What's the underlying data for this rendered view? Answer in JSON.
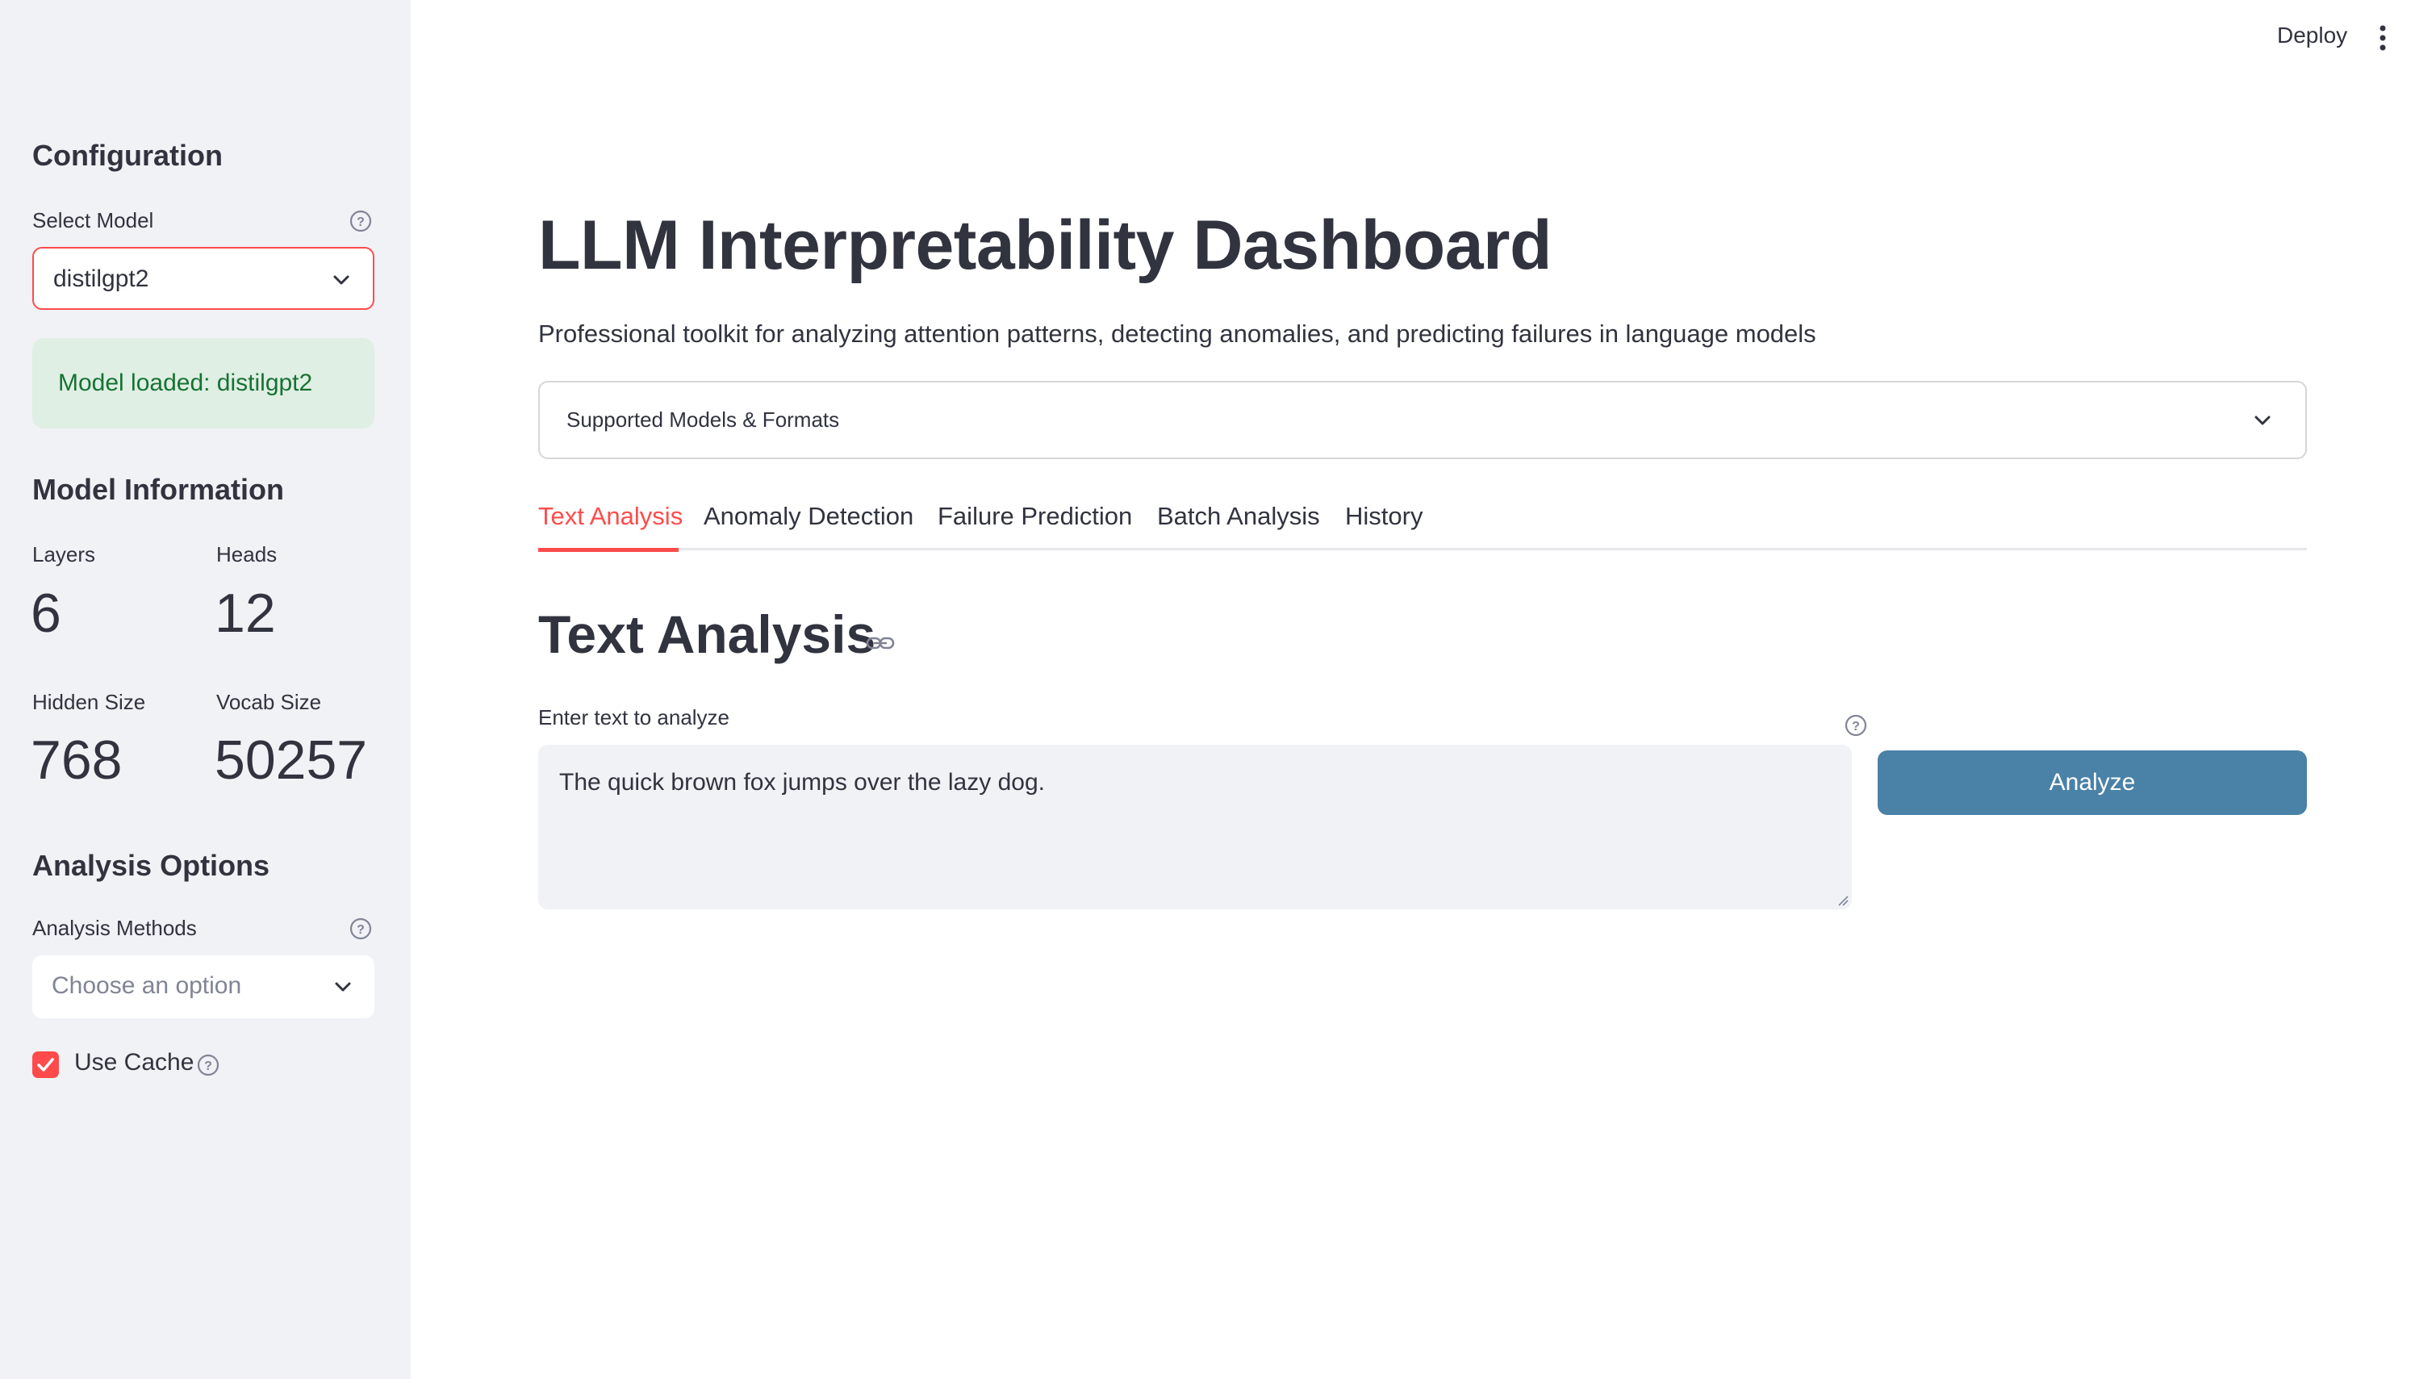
{
  "header": {
    "deploy_label": "Deploy",
    "menu_icon": "kebab-menu-icon"
  },
  "sidebar": {
    "config_heading": "Configuration",
    "select_model_label": "Select Model",
    "select_model_value": "distilgpt2",
    "success_message": "Model loaded: distilgpt2",
    "model_info_heading": "Model Information",
    "metrics": [
      {
        "label": "Layers",
        "value": "6"
      },
      {
        "label": "Heads",
        "value": "12"
      },
      {
        "label": "Hidden Size",
        "value": "768"
      },
      {
        "label": "Vocab Size",
        "value": "50257"
      }
    ],
    "analysis_options_heading": "Analysis Options",
    "analysis_methods_label": "Analysis Methods",
    "analysis_methods_placeholder": "Choose an option",
    "use_cache_label": "Use Cache",
    "use_cache_checked": true
  },
  "main": {
    "title": "LLM Interpretability Dashboard",
    "subtitle": "Professional toolkit for analyzing attention patterns, detecting anomalies, and predicting failures in language models",
    "expander_label": "Supported Models & Formats",
    "tabs": [
      {
        "label": "Text Analysis",
        "active": true
      },
      {
        "label": "Anomaly Detection",
        "active": false
      },
      {
        "label": "Failure Prediction",
        "active": false
      },
      {
        "label": "Batch Analysis",
        "active": false
      },
      {
        "label": "History",
        "active": false
      }
    ],
    "section_heading": "Text Analysis",
    "input_label": "Enter text to analyze",
    "input_value": "The quick brown fox jumps over the lazy dog.",
    "analyze_button": "Analyze"
  },
  "colors": {
    "accent": "#ff4b4b",
    "primary_button": "#4a81a7",
    "sidebar_bg": "#f0f2f6",
    "success_bg": "#dfefe3",
    "success_text": "#177233"
  }
}
